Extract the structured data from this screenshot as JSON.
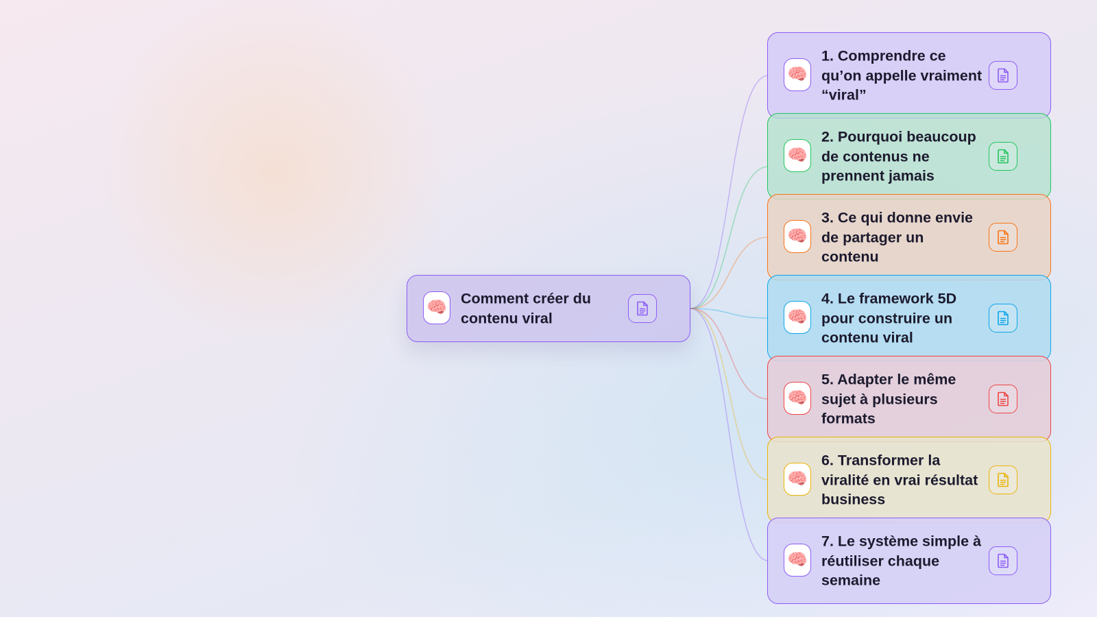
{
  "mindmap": {
    "root": {
      "label": "Comment créer du contenu viral",
      "color": "#8b5cf6",
      "fill": "rgba(201, 190, 236, 0.7)",
      "icon": "brain-icon",
      "doc_icon": "document-icon"
    },
    "children": [
      {
        "label": "1. Comprendre ce qu’on appelle vraiment “viral”",
        "color": "#8b5cf6",
        "fill": "rgba(214, 205, 247, 0.9)",
        "icon": "brain-icon",
        "doc_icon": "document-icon"
      },
      {
        "label": "2. Pourquoi beaucoup de contenus ne prennent jamais",
        "color": "#22c55e",
        "fill": "rgba(180, 225, 205, 0.78)",
        "icon": "brain-icon",
        "doc_icon": "document-icon"
      },
      {
        "label": "3. Ce qui donne envie de partager un contenu",
        "color": "#f97316",
        "fill": "rgba(232, 210, 195, 0.82)",
        "icon": "brain-icon",
        "doc_icon": "document-icon"
      },
      {
        "label": "4. Le framework 5D pour construire un contenu viral",
        "color": "#0ea5e9",
        "fill": "rgba(175, 218, 240, 0.85)",
        "icon": "brain-icon",
        "doc_icon": "document-icon"
      },
      {
        "label": "5. Adapter le même sujet à plusieurs formats",
        "color": "#ef4444",
        "fill": "rgba(228, 205, 216, 0.88)",
        "icon": "brain-icon",
        "doc_icon": "document-icon"
      },
      {
        "label": "6. Transformer la viralité en vrai résultat business",
        "color": "#eab308",
        "fill": "rgba(232, 226, 205, 0.88)",
        "icon": "brain-icon",
        "doc_icon": "document-icon"
      },
      {
        "label": "7. Le système simple à réutiliser chaque semaine",
        "color": "#8b5cf6",
        "fill": "rgba(214, 208, 246, 0.92)",
        "icon": "brain-icon",
        "doc_icon": "document-icon"
      }
    ]
  }
}
